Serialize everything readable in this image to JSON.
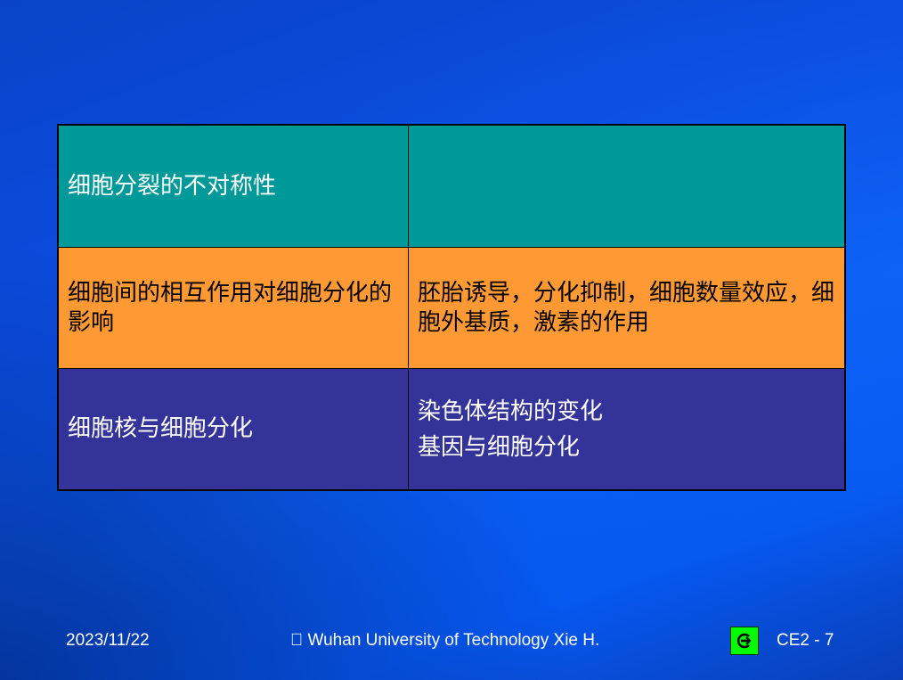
{
  "table": {
    "rows": [
      {
        "left": "细胞分裂的不对称性",
        "right": ""
      },
      {
        "left": "细胞间的相互作用对细胞分化的影响",
        "right": "胚胎诱导，分化抑制，细胞数量效应，细胞外基质，激素的作用"
      },
      {
        "left": "细胞核与细胞分化",
        "right_lines": [
          "染色体结构的变化",
          "基因与细胞分化"
        ]
      }
    ],
    "colors": {
      "row1": "#009999",
      "row2": "#ff9933",
      "row3": "#333399"
    }
  },
  "footer": {
    "date": "2023/11/22",
    "credit": "\u0000 Wuhan University of Technology  Xie H.",
    "page": "CE2 - 7"
  },
  "nav_button": {
    "icon": "return-icon",
    "color": "#00ff00"
  }
}
